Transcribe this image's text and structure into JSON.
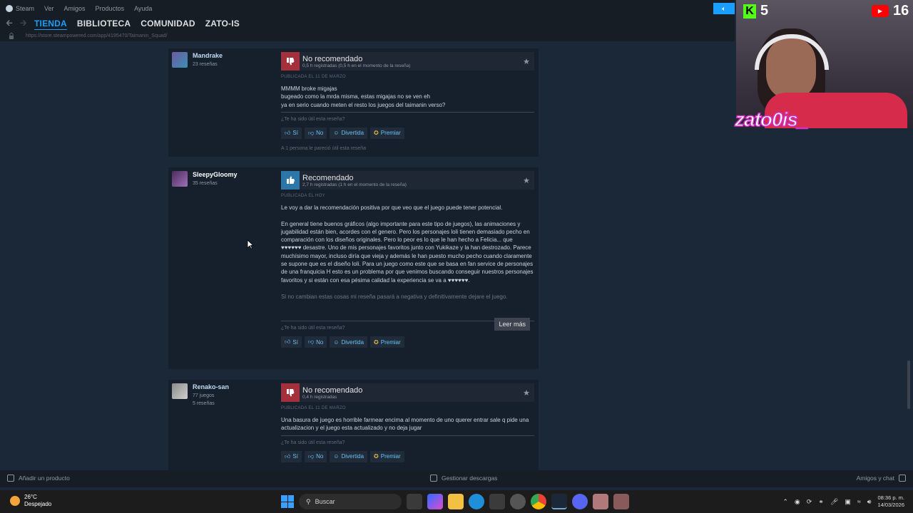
{
  "titlebar": {
    "menu": [
      "Steam",
      "Ver",
      "Amigos",
      "Productos",
      "Ayuda"
    ]
  },
  "navbar": {
    "tabs": [
      "TIENDA",
      "BIBLIOTECA",
      "COMUNIDAD",
      "ZATO-IS"
    ],
    "active_tab": "TIENDA"
  },
  "url": "https://store.steampowered.com/app/4195470/Taimanin_Squad/",
  "vote": {
    "question": "¿Te ha sido útil esta reseña?",
    "yes": "Sí",
    "no": "No",
    "funny": "Divertida",
    "award": "Premiar"
  },
  "reviews": [
    {
      "author": "Mandrake",
      "meta": [
        "23 reseñas"
      ],
      "verdict": "No recomendado",
      "hours": "0,5 h registradas (0,5 h en el momento de la reseña)",
      "posted": "PUBLICADA EL 11 DE MARZO",
      "text": "MMMM broke migajas\nbugeado como la mrda misma, estas migajas no se ven eh\nya en serio cuando meten el resto los juegos del taimanin verso?",
      "found_helpful": "A 1 persona le pareció útil esta reseña"
    },
    {
      "author": "SleepyGloomy",
      "meta": [
        "35 reseñas"
      ],
      "verdict": "Recomendado",
      "hours": "2,7 h registradas (1 h en el momento de la reseña)",
      "posted": "PUBLICADA EL HOY",
      "text": "Le voy a dar la recomendación positiva por que veo que el juego puede tener potencial.\n\nEn general tiene buenos gráficos (algo importante para este tipo de juegos), las animaciones y jugabilidad están bien, acordes con el genero. Pero los personajes loli tienen demasiado pecho en comparación con los diseños originales. Pero lo peor es lo que le han hecho a Felicia... que ♥♥♥♥♥♥ desastre. Uno de mis personajes favoritos junto con Yukikaze y la han destrozado. Parece muchísimo mayor, incluso diría que vieja y además le han puesto mucho pecho cuando claramente se supone que es el diseño loli. Para un juego como este que se basa en fan service de personajes de una franquicia H esto es un problema por que venimos buscando conseguir nuestros personajes favoritos y si están con esa pésima calidad la experiencia se va a ♥♥♥♥♥♥.",
      "faded_text": "Si no cambian estas cosas mi reseña pasará a negativa y definitivamente dejare el juego.",
      "read_more": "Leer más"
    },
    {
      "author": "Renako-san",
      "meta": [
        "77 juegos",
        "5 reseñas"
      ],
      "verdict": "No recomendado",
      "hours": "0,4 h registradas",
      "posted": "PUBLICADA EL 11 DE MARZO",
      "text": "Una basura de juego es horrible farmear encima al momento de uno querer entrar sale q pide una actualizacion y el juego esta actualizado y no deja jugar"
    }
  ],
  "bottom_bar": {
    "add_product": "Añadir un producto",
    "downloads": "Gestionar descargas",
    "friends": "Amigos y chat"
  },
  "overlay": {
    "kick_count": "5",
    "youtube_count": "16",
    "logo": "zato0is_"
  },
  "taskbar": {
    "temperature": "26°C",
    "weather": "Despejado",
    "search": "Buscar",
    "time": "08:36 p. m.",
    "date": "14/03/2026"
  },
  "colors": {
    "accent": "#1a9fff",
    "not_recommended": "#a3303b",
    "recommended": "#2d76a8",
    "award": "#e0b941"
  }
}
